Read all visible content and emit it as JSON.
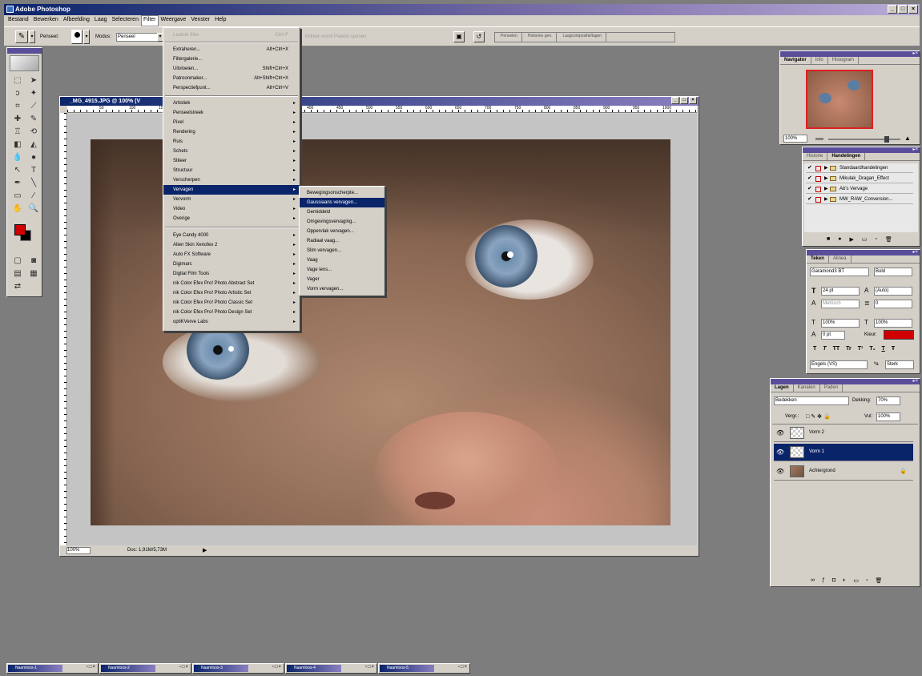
{
  "app": {
    "title": "Adobe Photoshop"
  },
  "window_buttons": {
    "min": "_",
    "max": "□",
    "close": "×"
  },
  "menubar": [
    "Bestand",
    "Bewerken",
    "Afbeelding",
    "Laag",
    "Selecteren",
    "Filter",
    "Weergave",
    "Venster",
    "Help"
  ],
  "options": {
    "brush_label": "Penseel:",
    "mode_label": "Modus:",
    "mode_value": "Penseel",
    "zoom_hint": "Klikken en/of Palette openen",
    "breadcrumbs": [
      "Penselen",
      "Histories gen.",
      "Laagcompositie/lagen"
    ]
  },
  "filter_menu": {
    "last_filter": "Laatste filter",
    "last_filter_shortcut": "Ctrl+F",
    "group1": [
      {
        "label": "Extraheren...",
        "shortcut": "Alt+Ctrl+X"
      },
      {
        "label": "Filtergalerie...",
        "shortcut": ""
      },
      {
        "label": "Uitvloeien...",
        "shortcut": "Shift+Ctrl+X"
      },
      {
        "label": "Patroonmaker...",
        "shortcut": "Alt+Shift+Ctrl+X"
      },
      {
        "label": "Perspectiefpunt...",
        "shortcut": "Alt+Ctrl+V"
      }
    ],
    "group2": [
      "Artistiek",
      "Penseelstreek",
      "Pixel",
      "Rendering",
      "Ruis",
      "Schets",
      "Stileer",
      "Structuur",
      "Verscherpen",
      "Vervagen",
      "Vervorm",
      "Video",
      "Overige"
    ],
    "highlighted": "Vervagen",
    "group3": [
      "Eye Candy 4000",
      "Alien Skin Xenofex 2",
      "Auto FX Software",
      "Digimarc",
      "Digital Film Tools",
      "nik Color Efex Pro! Photo Abstract Set",
      "nik Color Efex Pro! Photo Artistic Set",
      "nik Color Efex Pro! Photo Classic Set",
      "nik Color Efex Pro! Photo Design Set",
      "optiKVerve Labs"
    ],
    "arrow": "▸"
  },
  "submenu": {
    "items": [
      "Bewegingsonscherpte...",
      "Gaussiaans vervagen...",
      "Gemiddeld",
      "Omgevingsvervaging...",
      "Oppervlak vervagen...",
      "Radiaal vaag...",
      "Slim vervagen...",
      "Vaag",
      "Vage lens...",
      "Vager",
      "Vorm vervagen..."
    ],
    "highlighted": "Gaussiaans vervagen..."
  },
  "document": {
    "title": "_MG_4915.JPG @ 100% (V",
    "zoom": "100%",
    "doc_info": "Doc: 1,91M/5,73M",
    "ruler_labels": [
      "50",
      "100",
      "150",
      "200",
      "250",
      "300",
      "350",
      "400",
      "450",
      "500",
      "550",
      "600",
      "650",
      "700",
      "750",
      "800",
      "850",
      "900",
      "950",
      "1000"
    ]
  },
  "navigator": {
    "tabs": [
      "Navigator",
      "Info",
      "Histogram"
    ],
    "zoom": "100%"
  },
  "actions": {
    "tabs": [
      "Historie",
      "Handelingen"
    ],
    "rows": [
      "Standaardhandelingen",
      "Mikulak_Dragan_Effect",
      "Ab's Vervage",
      "MW_RAW_Conversion..."
    ]
  },
  "character": {
    "tabs": [
      "Teken",
      "Alinea"
    ],
    "font": "Garamond3 BT",
    "style": "Bold",
    "size": "24 pt",
    "leading": "(Auto)",
    "kerning": "Metrisch",
    "tracking": "0",
    "vscale": "100%",
    "hscale": "100%",
    "baseline": "0 pt",
    "color_label": "Kleur:",
    "color": "#d00000",
    "styles": [
      "T",
      "T",
      "TT",
      "Tr",
      "T¹",
      "T₁",
      "T",
      "Ŧ"
    ],
    "language": "Engels (VS)",
    "aa_label": "ªa",
    "antialias": "Sterk"
  },
  "layers": {
    "tabs": [
      "Lagen",
      "Kanalen",
      "Paden"
    ],
    "blend_mode": "Bedekken",
    "opacity_label": "Dekking:",
    "opacity": "70%",
    "lock_label": "Vergr.:",
    "fill_label": "Vul:",
    "fill": "100%",
    "rows": [
      {
        "name": "Vorm 2",
        "selected": false,
        "type": "transparent"
      },
      {
        "name": "Vorm 1",
        "selected": true,
        "type": "transparent"
      },
      {
        "name": "Achtergrond",
        "selected": false,
        "type": "image"
      }
    ],
    "lock_icon": "🔒"
  },
  "taskbar": [
    "Naamloos-1",
    "Naamloos-2",
    "Naamloos-3",
    "Naamloos-4",
    "Naamloos-5"
  ]
}
